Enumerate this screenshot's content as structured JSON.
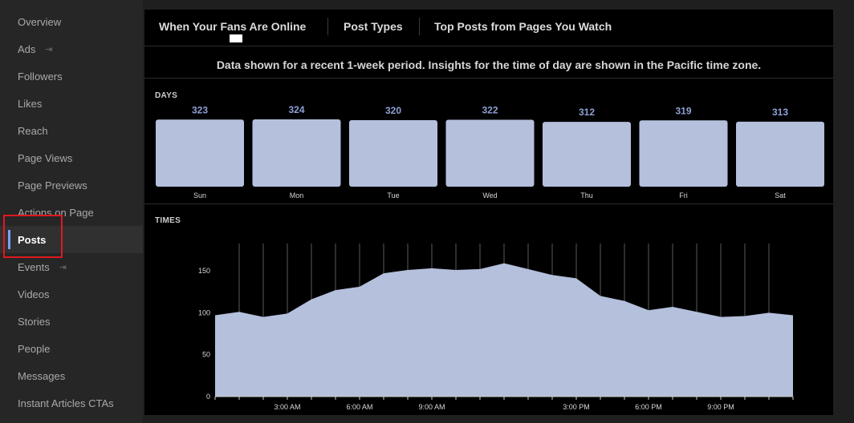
{
  "sidebar": {
    "items": [
      {
        "label": "Overview",
        "external": false,
        "active": false
      },
      {
        "label": "Ads",
        "external": true,
        "active": false
      },
      {
        "label": "Followers",
        "external": false,
        "active": false
      },
      {
        "label": "Likes",
        "external": false,
        "active": false
      },
      {
        "label": "Reach",
        "external": false,
        "active": false
      },
      {
        "label": "Page Views",
        "external": false,
        "active": false
      },
      {
        "label": "Page Previews",
        "external": false,
        "active": false
      },
      {
        "label": "Actions on Page",
        "external": false,
        "active": false
      },
      {
        "label": "Posts",
        "external": false,
        "active": true
      },
      {
        "label": "Events",
        "external": true,
        "active": false
      },
      {
        "label": "Videos",
        "external": false,
        "active": false
      },
      {
        "label": "Stories",
        "external": false,
        "active": false
      },
      {
        "label": "People",
        "external": false,
        "active": false
      },
      {
        "label": "Messages",
        "external": false,
        "active": false
      },
      {
        "label": "Instant Articles CTAs",
        "external": false,
        "active": false
      }
    ],
    "external_icon": "external-link-icon"
  },
  "tabs": [
    {
      "label": "When Your Fans Are Online",
      "active": true
    },
    {
      "label": "Post Types",
      "active": false
    },
    {
      "label": "Top Posts from Pages You Watch",
      "active": false
    }
  ],
  "info_text": "Data shown for a recent 1-week period. Insights for the time of day are shown in the Pacific time zone.",
  "colors": {
    "bar_fill": "#b4c0dc",
    "value_label": "#8ea0d4",
    "highlight": "#e0181e",
    "active_accent": "#7aa2ff"
  },
  "chart_data": [
    {
      "type": "bar",
      "title": "DAYS",
      "categories": [
        "Sun",
        "Mon",
        "Tue",
        "Wed",
        "Thu",
        "Fri",
        "Sat"
      ],
      "values": [
        323,
        324,
        320,
        322,
        312,
        319,
        313
      ],
      "data_labels": true
    },
    {
      "type": "area",
      "title": "TIMES",
      "x": [
        0,
        1,
        2,
        3,
        4,
        5,
        6,
        7,
        8,
        9,
        10,
        11,
        12,
        13,
        14,
        15,
        16,
        17,
        18,
        19,
        20,
        21,
        22,
        23
      ],
      "values": [
        97,
        101,
        95,
        99,
        116,
        127,
        131,
        147,
        151,
        153,
        151,
        152,
        159,
        152,
        145,
        141,
        120,
        114,
        103,
        107,
        101,
        95,
        96,
        100,
        97
      ],
      "x_tick_labels": [
        {
          "hour": 3,
          "label": "3:00 AM"
        },
        {
          "hour": 6,
          "label": "6:00 AM"
        },
        {
          "hour": 9,
          "label": "9:00 AM"
        },
        {
          "hour": 15,
          "label": "3:00 PM"
        },
        {
          "hour": 18,
          "label": "6:00 PM"
        },
        {
          "hour": 21,
          "label": "9:00 PM"
        }
      ],
      "y_ticks": [
        0,
        50,
        100,
        150
      ],
      "ylim": [
        0,
        175
      ],
      "grid": "vertical"
    }
  ]
}
